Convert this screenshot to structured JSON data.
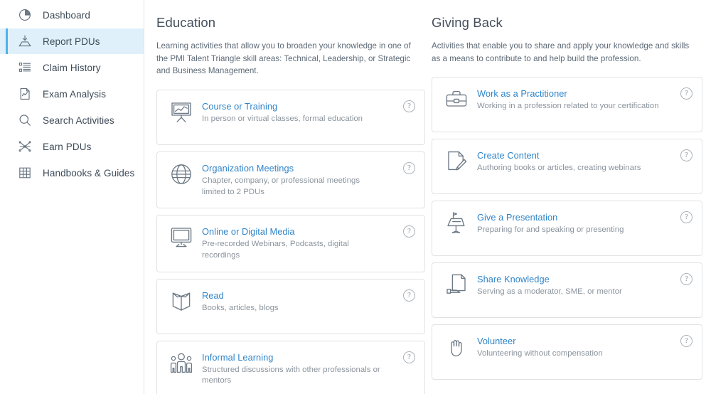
{
  "colors": {
    "accent_bar": "#4db3e8",
    "active_bg": "#dff0fb",
    "link": "#2f84c8",
    "heading": "#44505c",
    "body_text": "#5d6a77",
    "muted_text": "#8b949d",
    "card_border": "#e0e2e4",
    "sidebar_divider": "#e3e3e3",
    "icon_stroke": "#6c7884"
  },
  "sidebar": {
    "items": [
      {
        "label": "Dashboard",
        "icon": "pie-chart-icon",
        "active": false
      },
      {
        "label": "Report PDUs",
        "icon": "inbox-down-icon",
        "active": true
      },
      {
        "label": "Claim History",
        "icon": "list-icon",
        "active": false
      },
      {
        "label": "Exam Analysis",
        "icon": "document-chart-icon",
        "active": false
      },
      {
        "label": "Search Activities",
        "icon": "search-icon",
        "active": false
      },
      {
        "label": "Earn PDUs",
        "icon": "network-icon",
        "active": false
      },
      {
        "label": "Handbooks & Guides",
        "icon": "grid-icon",
        "active": false
      }
    ]
  },
  "columns": [
    {
      "key": "education",
      "title": "Education",
      "description": "Learning activities that allow you to broaden your knowledge in one of the PMI Talent Triangle skill areas: Technical, Leadership, or Strategic and Business Management.",
      "cards": [
        {
          "title": "Course or Training",
          "subtitle": "In person or virtual classes, formal education",
          "icon": "presentation-board-icon",
          "help_label": "?"
        },
        {
          "title": "Organization Meetings",
          "subtitle": "Chapter, company, or professional meetings limited to 2 PDUs",
          "icon": "globe-icon",
          "help_label": "?"
        },
        {
          "title": "Online or Digital Media",
          "subtitle": "Pre-recorded Webinars, Podcasts, digital recordings",
          "icon": "monitor-icon",
          "help_label": "?"
        },
        {
          "title": "Read",
          "subtitle": "Books, articles, blogs",
          "icon": "open-book-icon",
          "help_label": "?"
        },
        {
          "title": "Informal Learning",
          "subtitle": "Structured discussions with other professionals or mentors",
          "icon": "people-group-icon",
          "help_label": "?"
        }
      ]
    },
    {
      "key": "giving_back",
      "title": "Giving Back",
      "description": "Activities that enable you to share and apply your knowledge and skills as a means to contribute to and help build the profession.",
      "cards": [
        {
          "title": "Work as a Practitioner",
          "subtitle": "Working in a profession related to your certification",
          "icon": "briefcase-icon",
          "help_label": "?"
        },
        {
          "title": "Create Content",
          "subtitle": "Authoring books or articles, creating webinars",
          "icon": "document-pencil-icon",
          "help_label": "?"
        },
        {
          "title": "Give a Presentation",
          "subtitle": "Preparing for and speaking or presenting",
          "icon": "podium-icon",
          "help_label": "?"
        },
        {
          "title": "Share Knowledge",
          "subtitle": "Serving as a moderator, SME, or mentor",
          "icon": "document-hand-icon",
          "help_label": "?"
        },
        {
          "title": "Volunteer",
          "subtitle": "Volunteering without compensation",
          "icon": "raised-hand-icon",
          "help_label": "?"
        }
      ]
    }
  ]
}
